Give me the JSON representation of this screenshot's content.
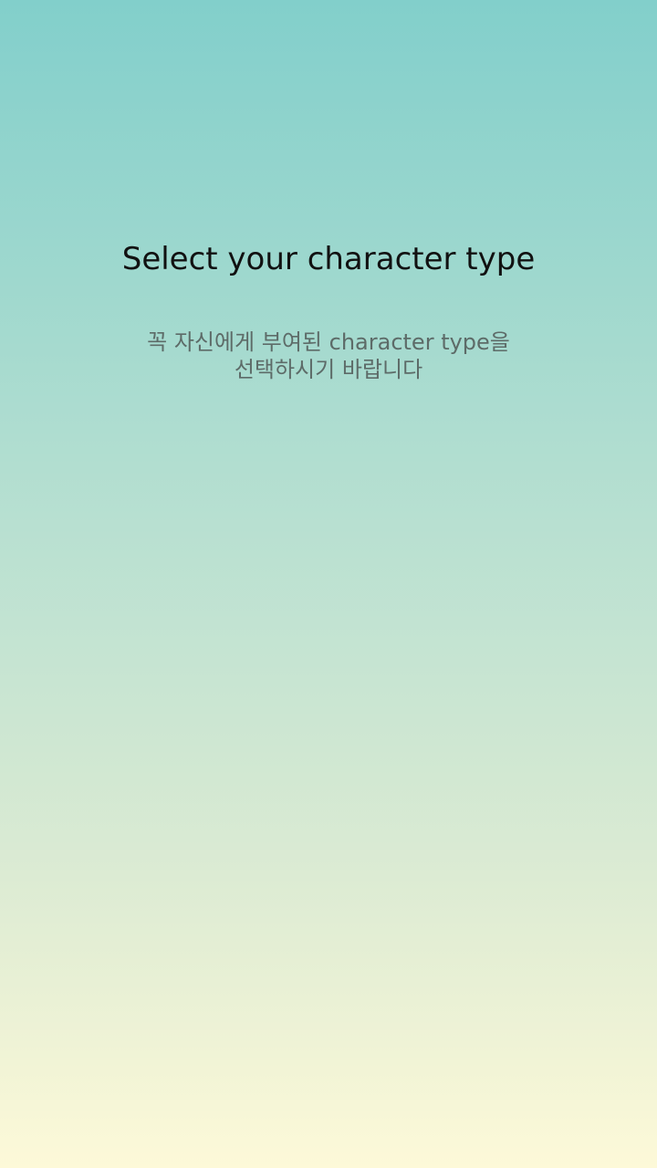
{
  "screen": {
    "title": "Select your character type",
    "subtitle_line1": "꼭 자신에게 부여된 character type을",
    "subtitle_line2": "선택하시기 바랍니다"
  },
  "colors": {
    "gradient_top": "#82cfcb",
    "gradient_bottom": "#fdf9d8",
    "title_text": "#111111",
    "subtitle_text": "#5d6b68"
  }
}
